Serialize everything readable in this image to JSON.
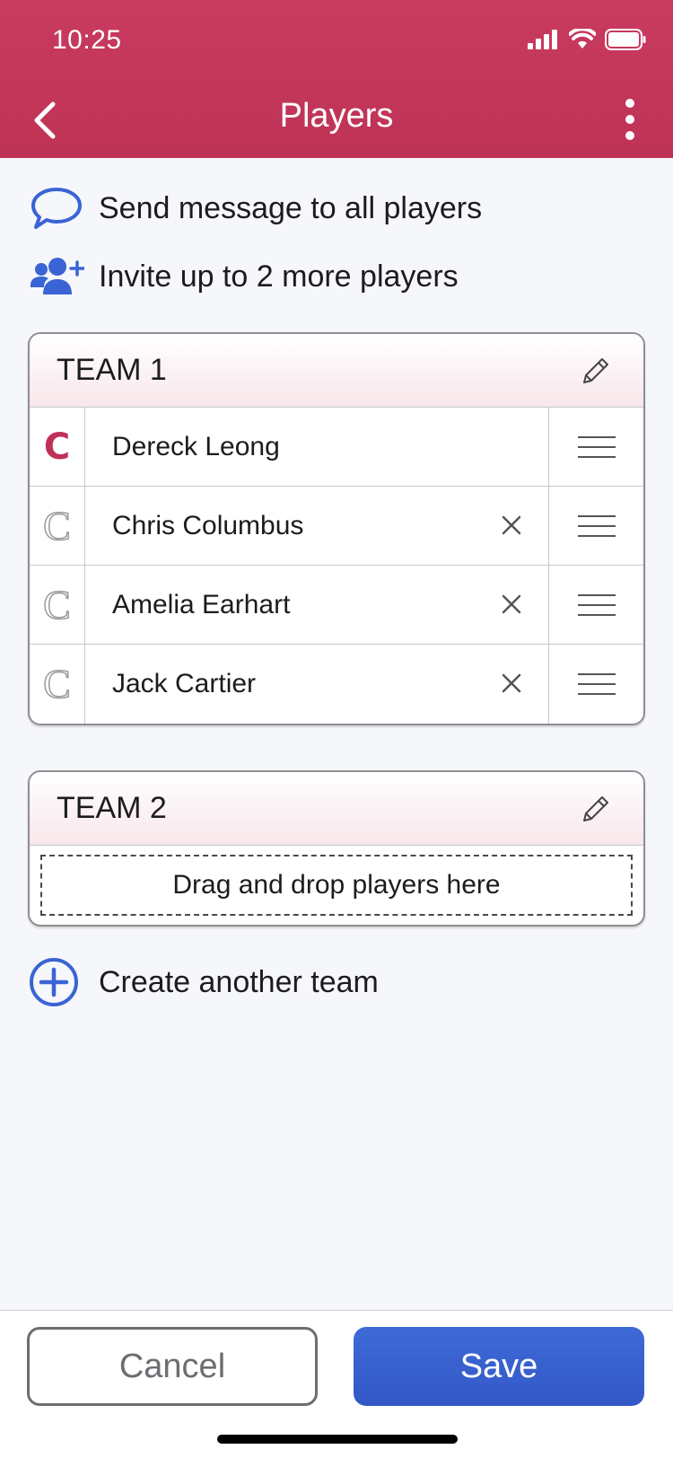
{
  "status_bar": {
    "time": "10:25"
  },
  "header": {
    "title": "Players"
  },
  "actions": {
    "message_all": "Send message to all players",
    "invite": "Invite up to 2 more players",
    "create_team": "Create another team"
  },
  "teams": [
    {
      "name": "TEAM 1",
      "players": [
        {
          "name": "Dereck Leong",
          "captain_glyph": "C",
          "is_captain": true
        },
        {
          "name": "Chris Columbus",
          "captain_glyph": "C",
          "is_captain": false
        },
        {
          "name": "Amelia Earhart",
          "captain_glyph": "C",
          "is_captain": false
        },
        {
          "name": "Jack Cartier",
          "captain_glyph": "C",
          "is_captain": false
        }
      ]
    },
    {
      "name": "TEAM 2",
      "drop_hint": "Drag and drop players here"
    }
  ],
  "footer": {
    "cancel_label": "Cancel",
    "save_label": "Save"
  },
  "colors": {
    "brand_red": "#c93a5f",
    "accent_blue": "#3a64d4"
  }
}
